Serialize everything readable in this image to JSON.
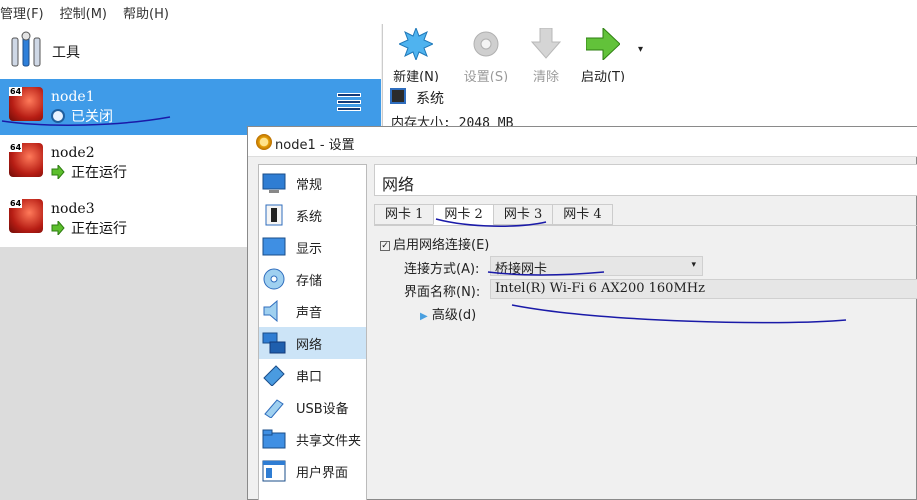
{
  "menu": {
    "items": [
      "管理(F)",
      "控制(M)",
      "帮助(H)"
    ]
  },
  "tools": {
    "label": "工具"
  },
  "vms": [
    {
      "name": "node1",
      "state": "已关闭",
      "badge": "64",
      "state_icon": "power-icon"
    },
    {
      "name": "node2",
      "state": "正在运行",
      "badge": "64",
      "state_icon": "green-arrow-icon"
    },
    {
      "name": "node3",
      "state": "正在运行",
      "badge": "64",
      "state_icon": "green-arrow-icon"
    }
  ],
  "toolbar": {
    "new_label": "新建(N)",
    "settings_label": "设置(S)",
    "discard_label": "清除",
    "start_label": "启动(T)"
  },
  "details": {
    "section_title": "系统",
    "memory_line": "内存大小: 2048 MB"
  },
  "dialog": {
    "title": "node1 - 设置",
    "categories": [
      "常规",
      "系统",
      "显示",
      "存储",
      "声音",
      "网络",
      "串口",
      "USB设备",
      "共享文件夹",
      "用户界面"
    ],
    "selected_category": "网络",
    "pane_title": "网络",
    "tabs": [
      "网卡 1",
      "网卡 2",
      "网卡 3",
      "网卡 4"
    ],
    "active_tab": "网卡 2",
    "enable_label": "启用网络连接(E)",
    "attach_label": "连接方式(A):",
    "attach_value": "桥接网卡",
    "iface_label": "界面名称(N):",
    "iface_value": "Intel(R) Wi-Fi 6 AX200 160MHz",
    "advanced_label": "高级(d)"
  },
  "colors": {
    "selection_blue": "#3f9be8",
    "category_selected": "#cce4f7",
    "annotation_ink": "#1a1aa8"
  }
}
